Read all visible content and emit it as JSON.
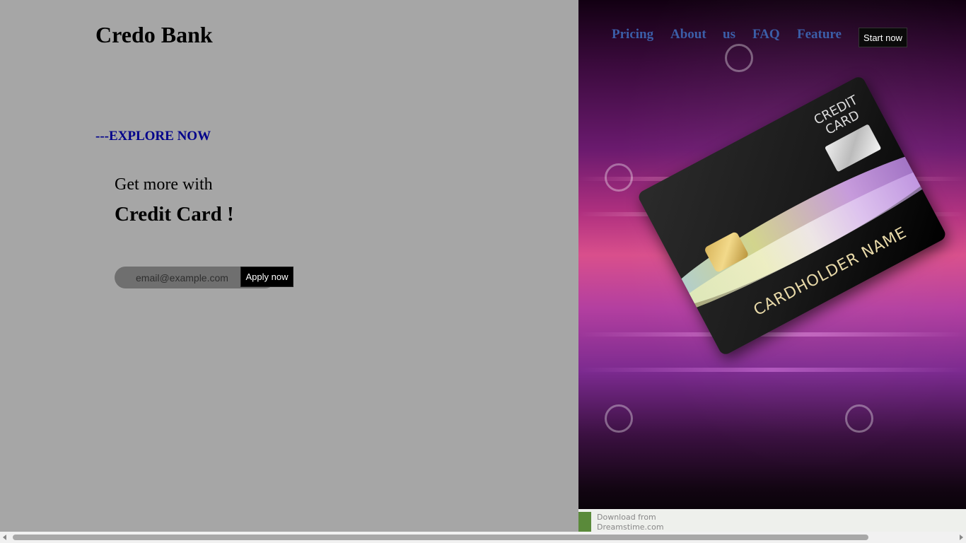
{
  "brand": {
    "name": "Credo Bank"
  },
  "nav": {
    "items": [
      {
        "label": "Pricing"
      },
      {
        "label": "About"
      },
      {
        "label": "us"
      },
      {
        "label": "FAQ"
      },
      {
        "label": "Feature"
      }
    ],
    "cta_label": "Start now"
  },
  "hero": {
    "explore_label": "---EXPLORE NOW",
    "subheading": "Get more with",
    "heading": "Credit Card !",
    "email_placeholder": "email@example.com",
    "apply_label": "Apply now"
  },
  "image": {
    "card_title": "CREDIT\nCARD",
    "card_holder": "CARDHOLDER NAME",
    "download_line1": "Download from",
    "download_line2": "Dreamstime.com"
  },
  "colors": {
    "page_background": "#a6a6a6",
    "nav_link": "#3b5ea8",
    "explore_link": "#00008b",
    "button_background": "#000000"
  }
}
